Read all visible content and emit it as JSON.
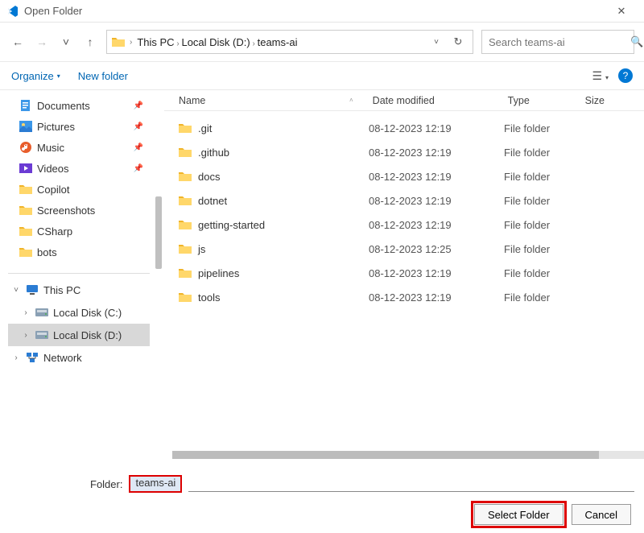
{
  "window": {
    "title": "Open Folder"
  },
  "nav": {
    "back": "←",
    "forward": "→",
    "down": "˅",
    "up": "↑"
  },
  "breadcrumb": [
    "This PC",
    "Local Disk (D:)",
    "teams-ai"
  ],
  "search": {
    "placeholder": "Search teams-ai"
  },
  "toolbar": {
    "organize": "Organize",
    "newfolder": "New folder"
  },
  "columns": {
    "name": "Name",
    "date": "Date modified",
    "type": "Type",
    "size": "Size"
  },
  "sidebar_quick": [
    {
      "kind": "docs",
      "label": "Documents",
      "pinned": true
    },
    {
      "kind": "pics",
      "label": "Pictures",
      "pinned": true
    },
    {
      "kind": "music",
      "label": "Music",
      "pinned": true
    },
    {
      "kind": "vids",
      "label": "Videos",
      "pinned": true
    },
    {
      "kind": "fold",
      "label": "Copilot",
      "pinned": false
    },
    {
      "kind": "fold",
      "label": "Screenshots",
      "pinned": false
    },
    {
      "kind": "fold",
      "label": "CSharp",
      "pinned": false
    },
    {
      "kind": "fold",
      "label": "bots",
      "pinned": false
    }
  ],
  "sidebar_tree": [
    {
      "label": "This PC",
      "icon": "pc",
      "expanded": true,
      "indent": 0,
      "sel": false
    },
    {
      "label": "Local Disk (C:)",
      "icon": "disk",
      "expanded": false,
      "indent": 1,
      "sel": false
    },
    {
      "label": "Local Disk (D:)",
      "icon": "disk",
      "expanded": false,
      "indent": 1,
      "sel": true
    },
    {
      "label": "Network",
      "icon": "net",
      "expanded": false,
      "indent": 0,
      "sel": false
    }
  ],
  "files": [
    {
      "name": ".git",
      "date": "08-12-2023 12:19",
      "type": "File folder"
    },
    {
      "name": ".github",
      "date": "08-12-2023 12:19",
      "type": "File folder"
    },
    {
      "name": "docs",
      "date": "08-12-2023 12:19",
      "type": "File folder"
    },
    {
      "name": "dotnet",
      "date": "08-12-2023 12:19",
      "type": "File folder"
    },
    {
      "name": "getting-started",
      "date": "08-12-2023 12:19",
      "type": "File folder"
    },
    {
      "name": "js",
      "date": "08-12-2023 12:25",
      "type": "File folder"
    },
    {
      "name": "pipelines",
      "date": "08-12-2023 12:19",
      "type": "File folder"
    },
    {
      "name": "tools",
      "date": "08-12-2023 12:19",
      "type": "File folder"
    }
  ],
  "footer": {
    "folder_label": "Folder:",
    "folder_value": "teams-ai",
    "select": "Select Folder",
    "cancel": "Cancel"
  }
}
